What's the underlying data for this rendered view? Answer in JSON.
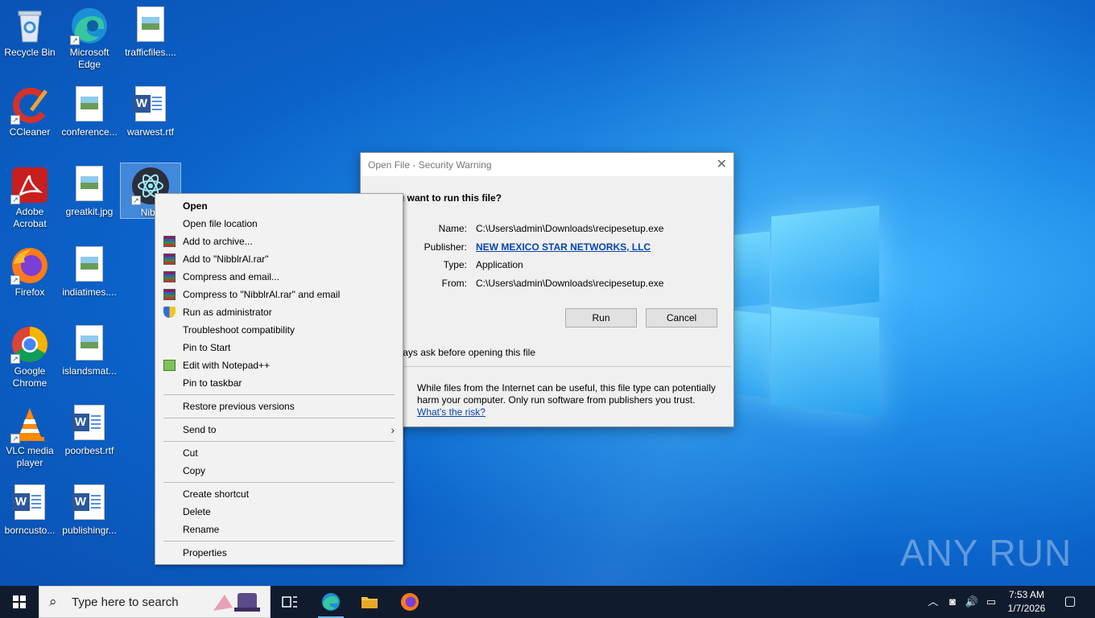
{
  "desktop": {
    "icons": [
      {
        "label": "Recycle Bin"
      },
      {
        "label": "Microsoft Edge"
      },
      {
        "label": "trafficfiles...."
      },
      {
        "label": "CCleaner"
      },
      {
        "label": "conference..."
      },
      {
        "label": "warwest.rtf"
      },
      {
        "label": "Adobe Acrobat"
      },
      {
        "label": "greatkit.jpg"
      },
      {
        "label": "Nibb"
      },
      {
        "label": "Firefox"
      },
      {
        "label": "indiatimes...."
      },
      {
        "label": "Google Chrome"
      },
      {
        "label": "islandsmat..."
      },
      {
        "label": "VLC media player"
      },
      {
        "label": "poorbest.rtf"
      },
      {
        "label": "borncusto..."
      },
      {
        "label": "publishingr..."
      }
    ]
  },
  "context_menu": {
    "items": [
      {
        "label": "Open"
      },
      {
        "label": "Open file location"
      },
      {
        "label": "Add to archive..."
      },
      {
        "label": "Add to \"NibblrAl.rar\""
      },
      {
        "label": "Compress and email..."
      },
      {
        "label": "Compress to \"NibblrAl.rar\" and email"
      },
      {
        "label": "Run as administrator"
      },
      {
        "label": "Troubleshoot compatibility"
      },
      {
        "label": "Pin to Start"
      },
      {
        "label": "Edit with Notepad++"
      },
      {
        "label": "Pin to taskbar"
      },
      {
        "label": "Restore previous versions"
      },
      {
        "label": "Send to"
      },
      {
        "label": "Cut"
      },
      {
        "label": "Copy"
      },
      {
        "label": "Create shortcut"
      },
      {
        "label": "Delete"
      },
      {
        "label": "Rename"
      },
      {
        "label": "Properties"
      }
    ]
  },
  "dialog": {
    "title": "Open File - Security Warning",
    "question": "u want to run this file?",
    "fields": {
      "name_label": "Name:",
      "name_value": "C:\\Users\\admin\\Downloads\\recipesetup.exe",
      "publisher_label": "Publisher:",
      "publisher_value": "NEW MEXICO STAR NETWORKS, LLC",
      "type_label": "Type:",
      "type_value": "Application",
      "from_label": "From:",
      "from_value": "C:\\Users\\admin\\Downloads\\recipesetup.exe"
    },
    "run_label": "Run",
    "cancel_label": "Cancel",
    "always_ask": "ays ask before opening this file",
    "info_text": "While files from the Internet can be useful, this file type can potentially harm your computer. Only run software from publishers you trust.",
    "risk_link": "What's the risk?"
  },
  "watermark": "ANY RUN",
  "taskbar": {
    "search_placeholder": "Type here to search",
    "time": "7:53 AM",
    "date": "1/7/2026"
  }
}
